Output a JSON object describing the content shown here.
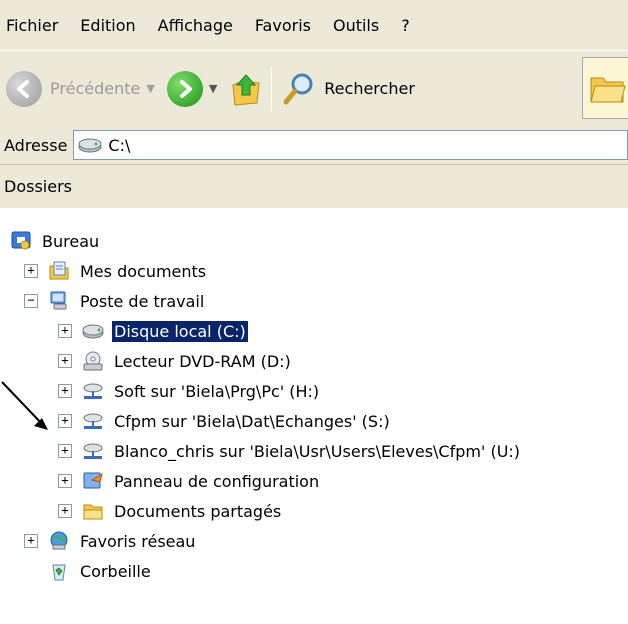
{
  "menubar": {
    "items": [
      "Fichier",
      "Edition",
      "Affichage",
      "Favoris",
      "Outils",
      "?"
    ]
  },
  "toolbar": {
    "back_label": "Précédente",
    "search_label": "Rechercher",
    "icons": [
      "back-arrow-icon",
      "forward-arrow-icon",
      "up-folder-icon",
      "search-icon",
      "folders-icon"
    ]
  },
  "address": {
    "label": "Adresse",
    "value": "C:\\"
  },
  "folders": {
    "title": "Dossiers"
  },
  "tree": [
    {
      "label": "Bureau",
      "icon": "desktop-icon"
    },
    {
      "label": "Mes documents",
      "icon": "my-documents-icon",
      "expander": "+"
    },
    {
      "label": "Poste de travail",
      "icon": "my-computer-icon",
      "expander": "−"
    },
    {
      "label": "Disque local (C:)",
      "icon": "hard-disk-icon",
      "expander": "+",
      "selected": true
    },
    {
      "label": "Lecteur DVD-RAM (D:)",
      "icon": "dvd-drive-icon",
      "expander": "+"
    },
    {
      "label": "Soft sur 'Biela\\Prg\\Pc' (H:)",
      "icon": "network-drive-icon",
      "expander": "+"
    },
    {
      "label": "Cfpm sur 'Biela\\Dat\\Echanges' (S:)",
      "icon": "network-drive-icon",
      "expander": "+"
    },
    {
      "label": "Blanco_chris sur 'Biela\\Usr\\Users\\Eleves\\Cfpm' (U:)",
      "icon": "network-drive-icon",
      "expander": "+"
    },
    {
      "label": "Panneau de configuration",
      "icon": "control-panel-icon",
      "expander": "+"
    },
    {
      "label": "Documents partagés",
      "icon": "shared-folder-icon",
      "expander": "+"
    },
    {
      "label": "Favoris réseau",
      "icon": "network-places-icon",
      "expander": "+"
    },
    {
      "label": "Corbeille",
      "icon": "recycle-bin-icon"
    }
  ],
  "colors": {
    "chrome": "#ece9d8",
    "selection": "#0a246a"
  }
}
